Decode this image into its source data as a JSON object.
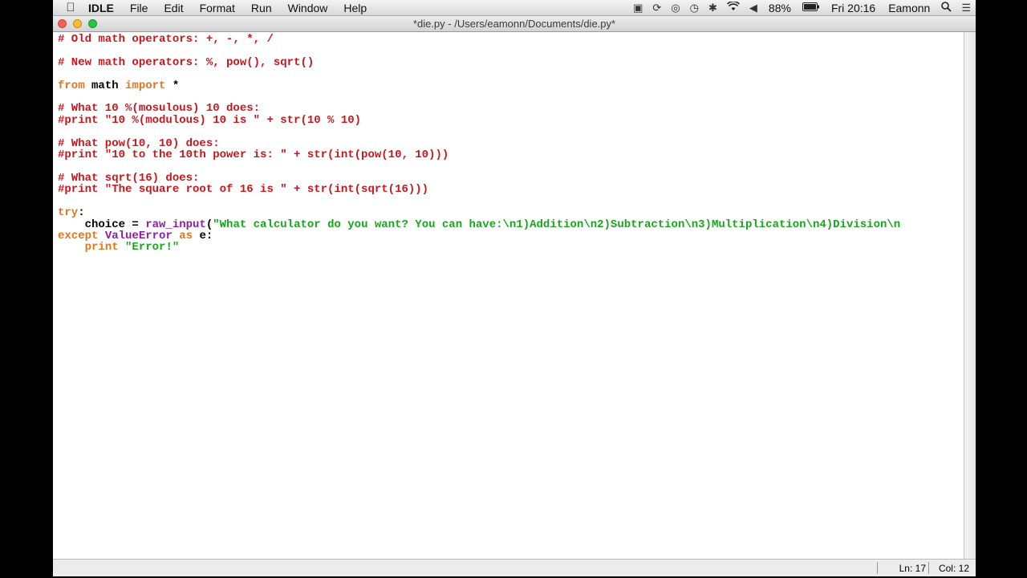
{
  "menubar": {
    "app_name": "IDLE",
    "items": [
      "File",
      "Edit",
      "Format",
      "Run",
      "Window",
      "Help"
    ],
    "status_icons": [
      "camera-icon",
      "sync-icon",
      "screen-share-icon",
      "time-machine-icon",
      "bluetooth-icon",
      "wifi-icon",
      "volume-icon"
    ],
    "battery": "88%",
    "clock": "Fri 20:16",
    "user": "Eamonn"
  },
  "window": {
    "title": "*die.py - /Users/eamonn/Documents/die.py*"
  },
  "code_lines": [
    [
      {
        "t": "# Old math operators: +, -, *, /",
        "c": "comment"
      }
    ],
    [],
    [
      {
        "t": "# New math operators: %, pow(), sqrt()",
        "c": "comment"
      }
    ],
    [],
    [
      {
        "t": "from",
        "c": "kw"
      },
      {
        "t": " math ",
        "c": "plain"
      },
      {
        "t": "import",
        "c": "kw"
      },
      {
        "t": " *",
        "c": "plain"
      }
    ],
    [],
    [
      {
        "t": "# What 10 %(mosulous) 10 does:",
        "c": "comment"
      }
    ],
    [
      {
        "t": "#print \"10 %(modulous) 10 is \" + str(10 % 10)",
        "c": "comment"
      }
    ],
    [],
    [
      {
        "t": "# What pow(10, 10) does:",
        "c": "comment"
      }
    ],
    [
      {
        "t": "#print \"10 to the 10th power is: \" + str(int(pow(10, 10)))",
        "c": "comment"
      }
    ],
    [],
    [
      {
        "t": "# What sqrt(16) does:",
        "c": "comment"
      }
    ],
    [
      {
        "t": "#print \"The square root of 16 is \" + str(int(sqrt(16)))",
        "c": "comment"
      }
    ],
    [],
    [
      {
        "t": "try",
        "c": "kw"
      },
      {
        "t": ":",
        "c": "plain"
      }
    ],
    [
      {
        "t": "    choice = ",
        "c": "plain"
      },
      {
        "t": "raw_input",
        "c": "builtin"
      },
      {
        "t": "(",
        "c": "plain"
      },
      {
        "t": "\"What calculator do you want? You can have:\\n1)Addition\\n2)Subtraction\\n3)Multiplication\\n4)Division\\n",
        "c": "str"
      }
    ],
    [
      {
        "t": "except",
        "c": "kw"
      },
      {
        "t": " ",
        "c": "plain"
      },
      {
        "t": "ValueError",
        "c": "builtin"
      },
      {
        "t": " ",
        "c": "plain"
      },
      {
        "t": "as",
        "c": "kw"
      },
      {
        "t": " e:",
        "c": "plain"
      }
    ],
    [
      {
        "t": "    ",
        "c": "plain"
      },
      {
        "t": "print",
        "c": "kw"
      },
      {
        "t": " ",
        "c": "plain"
      },
      {
        "t": "\"Error!\"",
        "c": "str"
      }
    ]
  ],
  "statusbar": {
    "line": "Ln: 17",
    "col": "Col: 12"
  },
  "colors": {
    "comment": "#c9161c",
    "keyword": "#e2761d",
    "builtin": "#8a1fa5",
    "string": "#1aa51f"
  }
}
